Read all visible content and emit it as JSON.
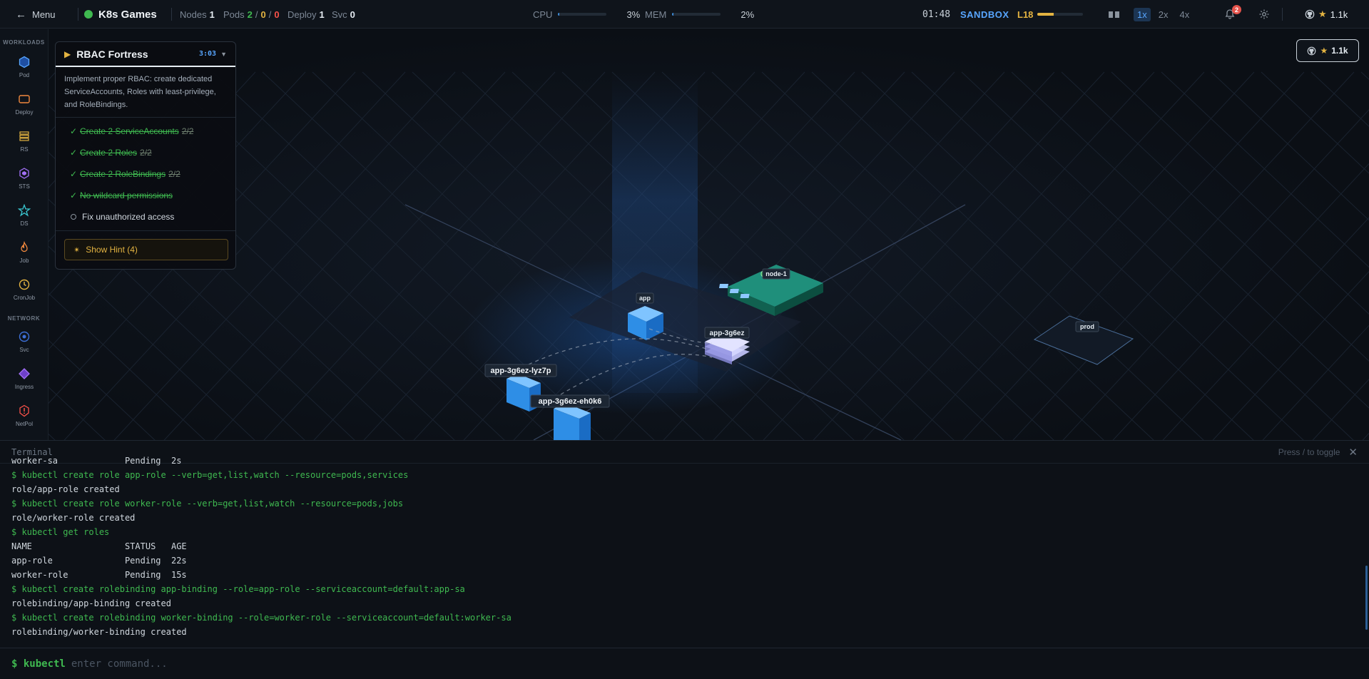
{
  "topbar": {
    "menu_label": "Menu",
    "brand": "K8s Games",
    "nodes_label": "Nodes",
    "nodes_value": "1",
    "pods_label": "Pods",
    "pods_running": "2",
    "pods_pending": "0",
    "pods_failed": "0",
    "deploy_label": "Deploy",
    "deploy_value": "1",
    "svc_label": "Svc",
    "svc_value": "0",
    "cpu_label": "CPU",
    "cpu_value": "3%",
    "cpu_fraction": 0.03,
    "mem_label": "MEM",
    "mem_value": "2%",
    "mem_fraction": 0.02,
    "clock": "01:48",
    "mode": "SANDBOX",
    "level": "L18",
    "level_progress": 0.35,
    "speeds": [
      "1x",
      "2x",
      "4x"
    ],
    "active_speed": "1x",
    "notifications": "2",
    "stars": "1.1k"
  },
  "colors": {
    "accent_blue": "#58a6ff",
    "green": "#3fb950",
    "amber": "#e3b341",
    "red": "#f85149"
  },
  "sidebar": {
    "section_workloads": "WORKLOADS",
    "section_network": "NETWORK",
    "workloads": [
      {
        "label": "Pod",
        "icon": "hexagon-icon"
      },
      {
        "label": "Deploy",
        "icon": "rectangle-icon"
      },
      {
        "label": "RS",
        "icon": "stack-icon"
      },
      {
        "label": "STS",
        "icon": "hexagon-small-icon"
      },
      {
        "label": "DS",
        "icon": "star-icon"
      },
      {
        "label": "Job",
        "icon": "flame-icon"
      },
      {
        "label": "CronJob",
        "icon": "clock-icon"
      }
    ],
    "network": [
      {
        "label": "Svc",
        "icon": "circle-icon"
      },
      {
        "label": "Ingress",
        "icon": "diamond-icon"
      },
      {
        "label": "NetPol",
        "icon": "shield-icon"
      }
    ]
  },
  "mission": {
    "title": "RBAC Fortress",
    "timer": "3:03",
    "description": "Implement proper RBAC: create dedicated ServiceAccounts, Roles with least-privilege, and RoleBindings.",
    "objectives": [
      {
        "text": "Create 2 ServiceAccounts",
        "count": "2/2",
        "done": true
      },
      {
        "text": "Create 2 Roles",
        "count": "2/2",
        "done": true
      },
      {
        "text": "Create 2 RoleBindings",
        "count": "2/2",
        "done": true
      },
      {
        "text": "No wildcard permissions",
        "count": "",
        "done": true
      },
      {
        "text": "Fix unauthorized access",
        "count": "",
        "done": false
      }
    ],
    "hint_label": "Show Hint (4)"
  },
  "scene": {
    "labels": {
      "node": "node-1",
      "deploy": "app",
      "replicaset": "app-3g6ez",
      "pod1": "app-3g6ez-lyz7p",
      "pod2": "app-3g6ez-eh0k6",
      "namespace": "prod"
    }
  },
  "terminal": {
    "title": "Terminal",
    "toggle_hint": "Press / to toggle",
    "lines": [
      {
        "kind": "out",
        "text": "worker-sa             Pending  2s"
      },
      {
        "kind": "cmd",
        "text": "$ kubectl create role app-role --verb=get,list,watch --resource=pods,services"
      },
      {
        "kind": "out",
        "text": "role/app-role created"
      },
      {
        "kind": "cmd",
        "text": "$ kubectl create role worker-role --verb=get,list,watch --resource=pods,jobs"
      },
      {
        "kind": "out",
        "text": "role/worker-role created"
      },
      {
        "kind": "cmd",
        "text": "$ kubectl get roles"
      },
      {
        "kind": "out",
        "text": "NAME                  STATUS   AGE"
      },
      {
        "kind": "out",
        "text": "app-role              Pending  22s"
      },
      {
        "kind": "out",
        "text": "worker-role           Pending  15s"
      },
      {
        "kind": "cmd",
        "text": "$ kubectl create rolebinding app-binding --role=app-role --serviceaccount=default:app-sa"
      },
      {
        "kind": "out",
        "text": "rolebinding/app-binding created"
      },
      {
        "kind": "cmd",
        "text": "$ kubectl create rolebinding worker-binding --role=worker-role --serviceaccount=default:worker-sa"
      },
      {
        "kind": "out",
        "text": "rolebinding/worker-binding created"
      }
    ],
    "prompt": "$ kubectl",
    "placeholder": "enter command..."
  }
}
